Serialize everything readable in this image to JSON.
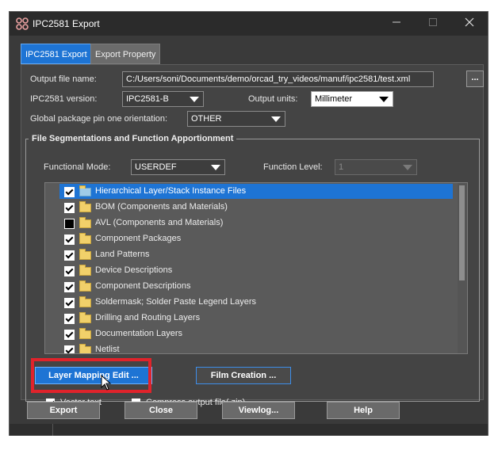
{
  "window": {
    "title": "IPC2581 Export"
  },
  "tabs": [
    {
      "label": "IPC2581 Export",
      "active": true
    },
    {
      "label": "Export Property",
      "active": false
    }
  ],
  "output": {
    "file_label": "Output file name:",
    "file_value": "C:/Users/soni/Documents/demo/orcad_try_videos/manuf/ipc2581/test.xml",
    "browse_label": "...",
    "version_label": "IPC2581 version:",
    "version_value": "IPC2581-B",
    "units_label": "Output units:",
    "units_value": "Millimeter",
    "orientation_label": "Global package pin one orientation:",
    "orientation_value": "OTHER"
  },
  "segmentation": {
    "title": "File Segmentations and Function Apportionment",
    "mode_label": "Functional Mode:",
    "mode_value": "USERDEF",
    "level_label": "Function Level:",
    "level_value": "1",
    "items": [
      {
        "label": "Hierarchical Layer/Stack Instance Files",
        "checked": true,
        "selected": true
      },
      {
        "label": "BOM (Components and Materials)",
        "checked": true,
        "selected": false
      },
      {
        "label": "AVL (Components and Materials)",
        "checked": false,
        "selected": false
      },
      {
        "label": "Component Packages",
        "checked": true,
        "selected": false
      },
      {
        "label": "Land Patterns",
        "checked": true,
        "selected": false
      },
      {
        "label": "Device Descriptions",
        "checked": true,
        "selected": false
      },
      {
        "label": "Component Descriptions",
        "checked": true,
        "selected": false
      },
      {
        "label": "Soldermask; Solder Paste Legend Layers",
        "checked": true,
        "selected": false
      },
      {
        "label": "Drilling and Routing Layers",
        "checked": true,
        "selected": false
      },
      {
        "label": "Documentation Layers",
        "checked": true,
        "selected": false
      },
      {
        "label": "Netlist",
        "checked": true,
        "selected": false
      }
    ]
  },
  "actions": {
    "layer_mapping": "Layer Mapping Edit ...",
    "film_creation": "Film Creation ..."
  },
  "options": {
    "vector_text": "Vector text",
    "vector_text_checked": true,
    "compress": "Compress output file(.zip)",
    "compress_checked": false
  },
  "buttons": {
    "export": "Export",
    "close": "Close",
    "viewlog": "Viewlog...",
    "help": "Help"
  },
  "colors": {
    "accent": "#1e74d4",
    "highlight_box": "#e0232b"
  }
}
